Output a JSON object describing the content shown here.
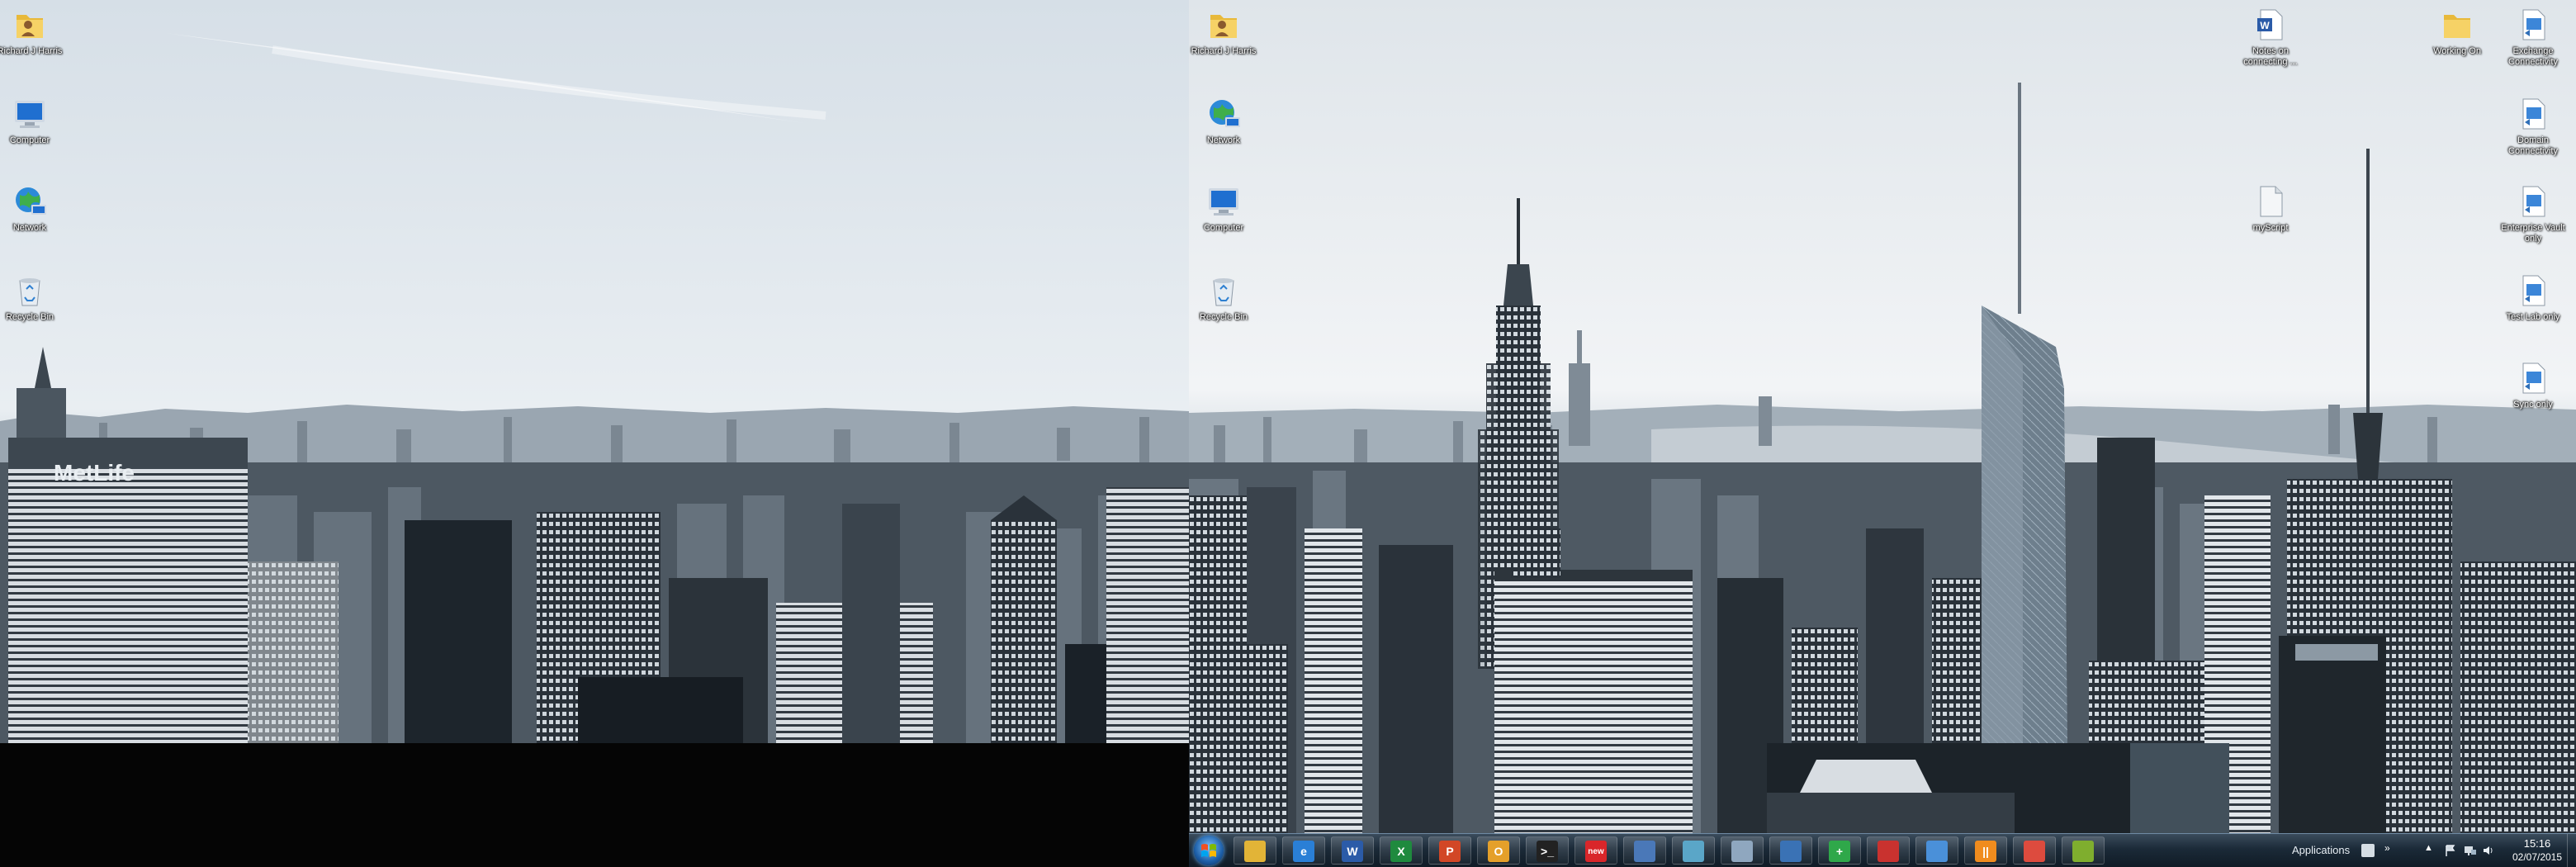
{
  "monitors": {
    "left": {
      "icons": [
        {
          "id": "user",
          "label": "Richard J Harris"
        },
        {
          "id": "computer",
          "label": "Computer"
        },
        {
          "id": "network",
          "label": "Network"
        },
        {
          "id": "recycle",
          "label": "Recycle Bin"
        }
      ],
      "sign_text": "MetLife"
    },
    "right": {
      "icons_left": [
        {
          "id": "user",
          "label": "Richard J Harris"
        },
        {
          "id": "network",
          "label": "Network"
        },
        {
          "id": "computer",
          "label": "Computer"
        },
        {
          "id": "recycle",
          "label": "Recycle Bin"
        }
      ],
      "icons_right": [
        {
          "id": "word-doc",
          "label": "Notes on connecting ..."
        },
        {
          "id": "file",
          "label": "myScript"
        },
        {
          "id": "folder",
          "label": "Working On"
        },
        {
          "id": "shortcut-1",
          "label": "Exchange Connectivity"
        },
        {
          "id": "shortcut-2",
          "label": "Domain Connectivity"
        },
        {
          "id": "shortcut-3",
          "label": "Enterprise Vault only"
        },
        {
          "id": "shortcut-4",
          "label": "Test Lab only"
        },
        {
          "id": "shortcut-5",
          "label": "Sync only"
        }
      ]
    }
  },
  "taskbar": {
    "apps": [
      {
        "name": "explorer",
        "color": "#e2b437",
        "icon": "folder-icon"
      },
      {
        "name": "internet-explorer",
        "color": "#2a7fd6",
        "icon": "ie-icon",
        "glyph": "e"
      },
      {
        "name": "word",
        "color": "#2b5ba8",
        "icon": "word-icon",
        "glyph": "W"
      },
      {
        "name": "excel",
        "color": "#1f8a3e",
        "icon": "excel-icon",
        "glyph": "X"
      },
      {
        "name": "powerpoint",
        "color": "#d24726",
        "icon": "powerpoint-icon",
        "glyph": "P"
      },
      {
        "name": "outlook",
        "color": "#e5a02a",
        "icon": "outlook-icon",
        "glyph": "O"
      },
      {
        "name": "command-prompt",
        "color": "#222222",
        "icon": "cmd-icon",
        "glyph": ">_"
      },
      {
        "name": "newsreader",
        "color": "#d9262a",
        "icon": "news-icon",
        "glyph": "new"
      },
      {
        "name": "remote-desktop",
        "color": "#4a78b8",
        "icon": "remote-desktop-icon"
      },
      {
        "name": "notepad",
        "color": "#5aa6c8",
        "icon": "notepad-icon"
      },
      {
        "name": "paint",
        "color": "#8fa7bf",
        "icon": "paint-icon"
      },
      {
        "name": "network-tool",
        "color": "#3a72b5",
        "icon": "network-tool-icon"
      },
      {
        "name": "health",
        "color": "#2fa84a",
        "icon": "plus-icon",
        "glyph": "+"
      },
      {
        "name": "pdf",
        "color": "#c9322f",
        "icon": "pdf-icon"
      },
      {
        "name": "security",
        "color": "#4a90d9",
        "icon": "shield-icon"
      },
      {
        "name": "media",
        "color": "#f08c1e",
        "icon": "media-icon",
        "glyph": "||"
      },
      {
        "name": "chrome",
        "color": "#dd4b3e",
        "icon": "chrome-icon"
      },
      {
        "name": "vmware",
        "color": "#7fae2e",
        "icon": "vm-icon"
      }
    ],
    "tray_label": "Applications",
    "clock_time": "15:16",
    "clock_date": "02/07/2015"
  },
  "colors": {
    "sky_top": "#dfe6ec",
    "sky_horizon": "#f3f5f7",
    "city_dark": "#1f2830",
    "city_mid": "#55616c",
    "taskbar": "#1b2a38"
  }
}
